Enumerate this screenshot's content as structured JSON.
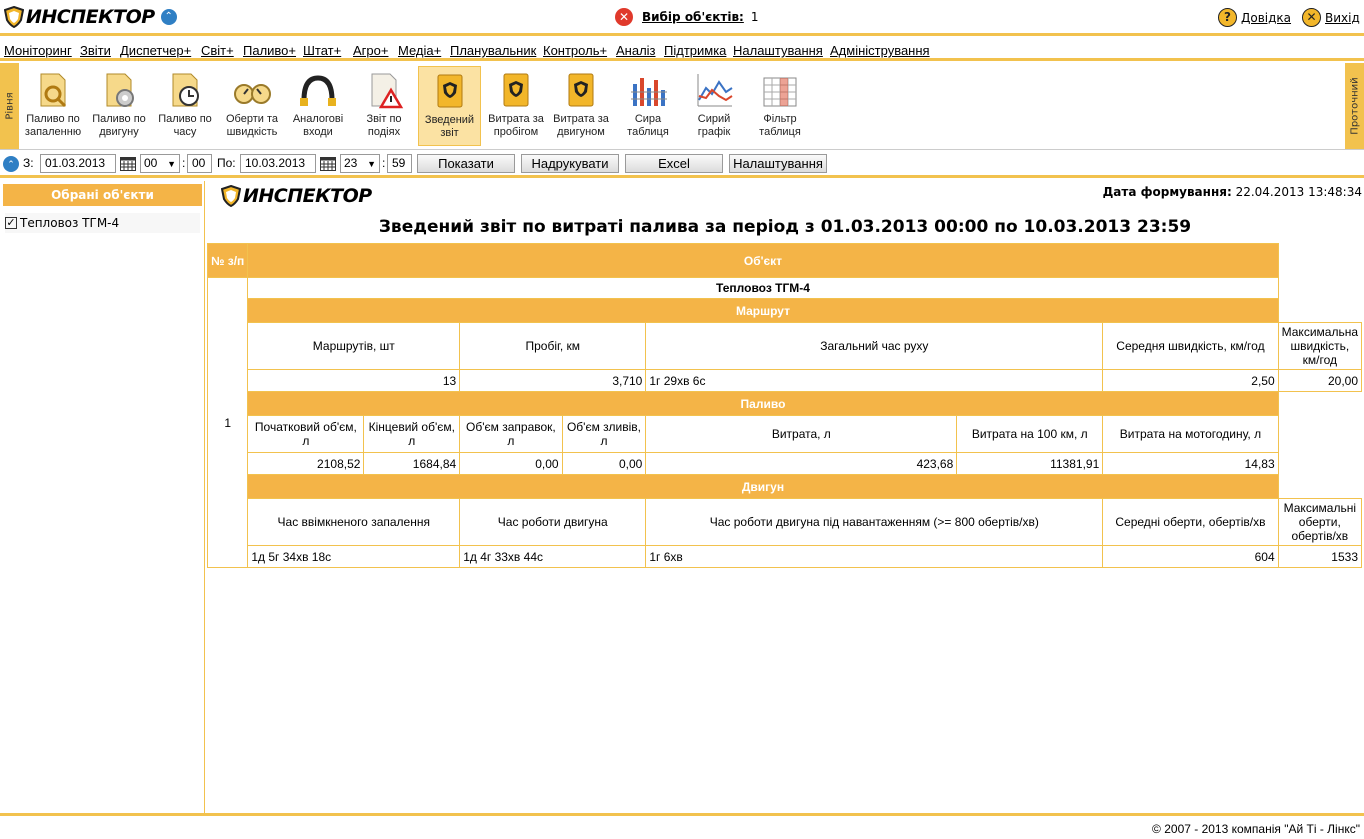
{
  "app": {
    "logo_text": "ИНСПЕКТОР"
  },
  "header": {
    "object_select_label": "Вибір об'єктів:",
    "object_select_count": "1",
    "help_label": "Довідка",
    "exit_label": "Вихід"
  },
  "menu": [
    "Моніторинг",
    "Звіти",
    "Диспетчер+",
    "Світ+",
    "Паливо+",
    "Штат+",
    "Агро+",
    "Медіа+",
    "Планувальник",
    "Контроль+",
    "Аналіз",
    "Підтримка",
    "Налаштування",
    "Адміністрування"
  ],
  "ribbon": {
    "left_tab": "Рівня",
    "right_tab": "Проточний",
    "items": [
      {
        "l1": "Паливо по",
        "l2": "запаленню",
        "icon": "fuel-ignition-icon"
      },
      {
        "l1": "Паливо по",
        "l2": "двигуну",
        "icon": "fuel-engine-icon"
      },
      {
        "l1": "Паливо по",
        "l2": "часу",
        "icon": "fuel-time-icon"
      },
      {
        "l1": "Оберти та",
        "l2": "швидкість",
        "icon": "gauges-icon"
      },
      {
        "l1": "Аналогові",
        "l2": "входи",
        "icon": "cable-icon"
      },
      {
        "l1": "Звіт по",
        "l2": "подіях",
        "icon": "events-warning-icon"
      },
      {
        "l1": "Зведений",
        "l2": "звіт",
        "icon": "summary-report-icon"
      },
      {
        "l1": "Витрата за",
        "l2": "пробігом",
        "icon": "consumption-mileage-icon"
      },
      {
        "l1": "Витрата за",
        "l2": "двигуном",
        "icon": "consumption-engine-icon"
      },
      {
        "l1": "Сира",
        "l2": "таблиця",
        "icon": "raw-table-icon"
      },
      {
        "l1": "Сирий",
        "l2": "графік",
        "icon": "raw-chart-icon"
      },
      {
        "l1": "Фільтр",
        "l2": "таблиця",
        "icon": "filter-table-icon"
      }
    ]
  },
  "toolbar": {
    "from_label": "З:",
    "from_date": "01.03.2013",
    "from_hour": "00",
    "from_min": "00",
    "to_label": "По:",
    "to_date": "10.03.2013",
    "to_hour": "23",
    "to_min": "59",
    "show_btn": "Показати",
    "print_btn": "Надрукувати",
    "excel_btn": "Excel",
    "settings_btn": "Налаштування"
  },
  "sidebar": {
    "title": "Обрані об'єкти",
    "items": [
      {
        "label": "Тепловоз ТГМ-4",
        "checked": true
      }
    ]
  },
  "report": {
    "gen_label": "Дата формування:",
    "gen_value": "22.04.2013 13:48:34",
    "title": "Зведений звіт по витраті палива за період з 01.03.2013 00:00 по 10.03.2013 23:59",
    "col_num": "№ з/п",
    "col_object": "Об'єкт",
    "row_num": "1",
    "object_name": "Тепловоз ТГМ-4",
    "sec_route": "Маршрут",
    "route_h": [
      "Маршрутів, шт",
      "Пробіг, км",
      "Загальний час руху",
      "Середня швидкість, км/год",
      "Максимальна швидкість, км/год"
    ],
    "route_v": [
      "13",
      "3,710",
      "1г 29хв 6с",
      "2,50",
      "20,00"
    ],
    "sec_fuel": "Паливо",
    "fuel_h": [
      "Початковий об'єм, л",
      "Кінцевий об'єм, л",
      "Об'єм заправок, л",
      "Об'єм зливів, л",
      "Витрата, л",
      "Витрата на 100 км, л",
      "Витрата на мотогодину, л"
    ],
    "fuel_v": [
      "2108,52",
      "1684,84",
      "0,00",
      "0,00",
      "423,68",
      "11381,91",
      "14,83"
    ],
    "sec_engine": "Двигун",
    "eng_h": [
      "Час ввімкненого запалення",
      "Час роботи двигуна",
      "Час роботи двигуна під навантаженням (>= 800 обертів/хв)",
      "Середні оберти, обертів/хв",
      "Максимальні оберти, обертів/хв"
    ],
    "eng_v": [
      "1д 5г 34хв 18с",
      "1д 4г 33хв 44с",
      "1г 6хв",
      "604",
      "1533"
    ]
  },
  "footer": {
    "copyright": "© 2007 - 2013 компанія \"Ай Ті - Лінкс\""
  },
  "colors": {
    "accent": "#f2c24e",
    "header_bg": "#f4b447",
    "error": "#e0392b"
  }
}
